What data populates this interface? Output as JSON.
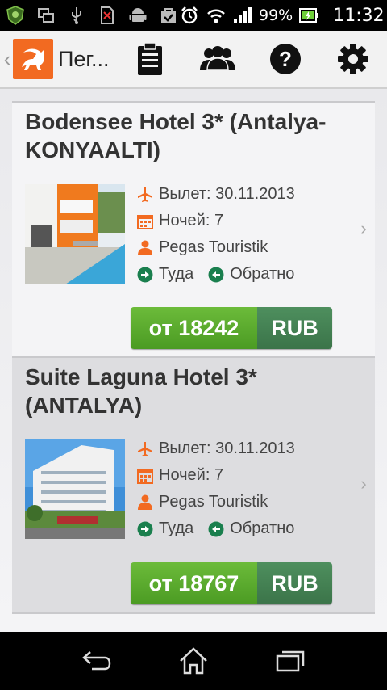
{
  "status_bar": {
    "battery": "99%",
    "time": "11:32",
    "icons": [
      "shield-app-icon",
      "screens-icon",
      "usb-icon",
      "no-sim-icon",
      "android-icon",
      "bag-check-icon",
      "alarm-icon",
      "wifi-icon",
      "signal-icon",
      "battery-icon"
    ]
  },
  "action_bar": {
    "title": "Пег...",
    "actions": [
      "clipboard-icon",
      "group-icon",
      "help-icon",
      "settings-icon"
    ]
  },
  "colors": {
    "accent_orange": "#f26a21",
    "price_green": "#5aab2e",
    "currency_green": "#447f52",
    "direction_green": "#1a7f4e"
  },
  "tours": [
    {
      "hotel": "Bodensee Hotel 3* (Antalya-KONYAALTI)",
      "departure": "Вылет: 30.11.2013",
      "nights": "Ночей: 7",
      "operator": "Pegas Touristik",
      "forward": "Туда",
      "back": "Обратно",
      "price": "от 18242",
      "currency": "RUB"
    },
    {
      "hotel": "Suite Laguna Hotel 3* (ANTALYA)",
      "departure": "Вылет: 30.11.2013",
      "nights": "Ночей: 7",
      "operator": "Pegas Touristik",
      "forward": "Туда",
      "back": "Обратно",
      "price": "от 18767",
      "currency": "RUB"
    }
  ],
  "nav_bar": [
    "back-icon",
    "home-icon",
    "recent-apps-icon"
  ]
}
